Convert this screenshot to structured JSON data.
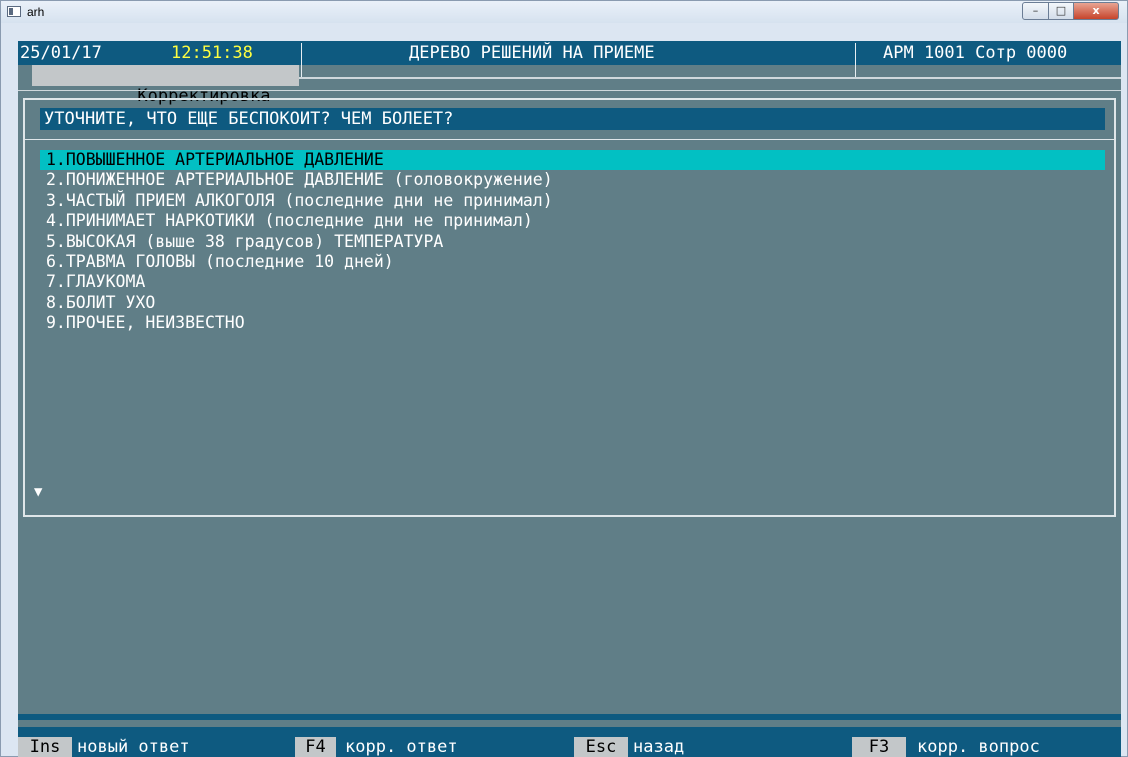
{
  "window": {
    "title": "arh",
    "minimize_label": "–",
    "maximize_label": "□",
    "close_label": "x"
  },
  "header": {
    "date": "25/01/17",
    "time": "12:51:38",
    "title": "ДЕРЕВО РЕШЕНИЙ НА ПРИЕМЕ",
    "workstation": "АРМ 1001 Сотр 0000",
    "mode_tab": "Корректировка"
  },
  "question": "УТОЧНИТЕ, ЧТО ЕЩЕ БЕСПОКОИТ? ЧЕМ БОЛЕЕТ?",
  "options": [
    "1.ПОВЫШЕННОЕ АРТЕРИАЛЬНОЕ ДАВЛЕНИЕ",
    "2.ПОНИЖЕННОЕ АРТЕРИАЛЬНОЕ ДАВЛЕНИЕ (головокружение)",
    "3.ЧАСТЫЙ ПРИЕМ АЛКОГОЛЯ (последние дни не принимал)",
    "4.ПРИНИМАЕТ НАРКОТИКИ (последние дни не принимал)",
    "5.ВЫСОКАЯ (выше 38 градусов) ТЕМПЕРАТУРА",
    "6.ТРАВМА ГОЛОВЫ (последние 10 дней)",
    "7.ГЛАУКОМА",
    "8.БОЛИТ УХО",
    "9.ПРОЧЕЕ, НЕИЗВЕСТНО"
  ],
  "selected_option": 1,
  "scroll_indicator": "▼",
  "hotkeys": [
    {
      "key": "Ins",
      "label": "новый ответ"
    },
    {
      "key": "F4",
      "label": "корр. ответ"
    },
    {
      "key": "Esc",
      "label": "назад"
    },
    {
      "key": "F3",
      "label": "корр. вопрос"
    }
  ],
  "colors": {
    "background": "#607e87",
    "bar": "#0e5a80",
    "highlight": "#02c0c3",
    "time": "#ffff40",
    "key_bg": "#c3c7c9"
  }
}
